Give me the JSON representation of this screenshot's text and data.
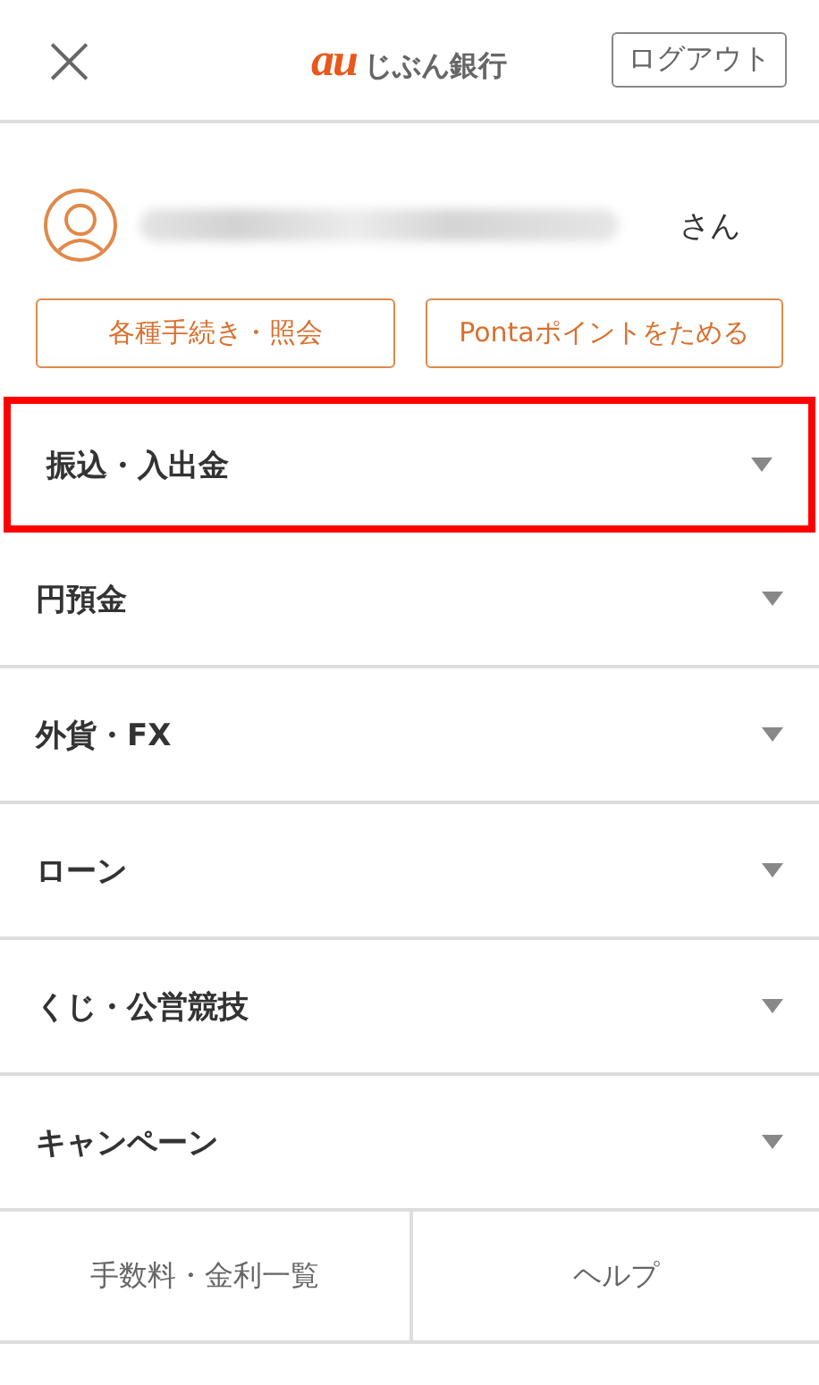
{
  "header": {
    "close": "×",
    "logo_mark": "au",
    "logo_text": "じぶん銀行",
    "logout": "ログアウト"
  },
  "profile": {
    "suffix": "さん",
    "name_redacted": true
  },
  "actions": [
    "各種手続き・照会",
    "Pontaポイントをためる"
  ],
  "menu": [
    {
      "label": "振込・入出金",
      "expanded": false,
      "highlighted": true
    },
    {
      "label": "円預金",
      "expanded": false,
      "highlighted": false
    },
    {
      "label": "外貨・FX",
      "expanded": false,
      "highlighted": false
    },
    {
      "label": "ローン",
      "expanded": false,
      "highlighted": false
    },
    {
      "label": "くじ・公営競技",
      "expanded": false,
      "highlighted": false
    },
    {
      "label": "キャンペーン",
      "expanded": false,
      "highlighted": false
    }
  ],
  "footer": [
    "手数料・金利一覧",
    "ヘルプ"
  ]
}
